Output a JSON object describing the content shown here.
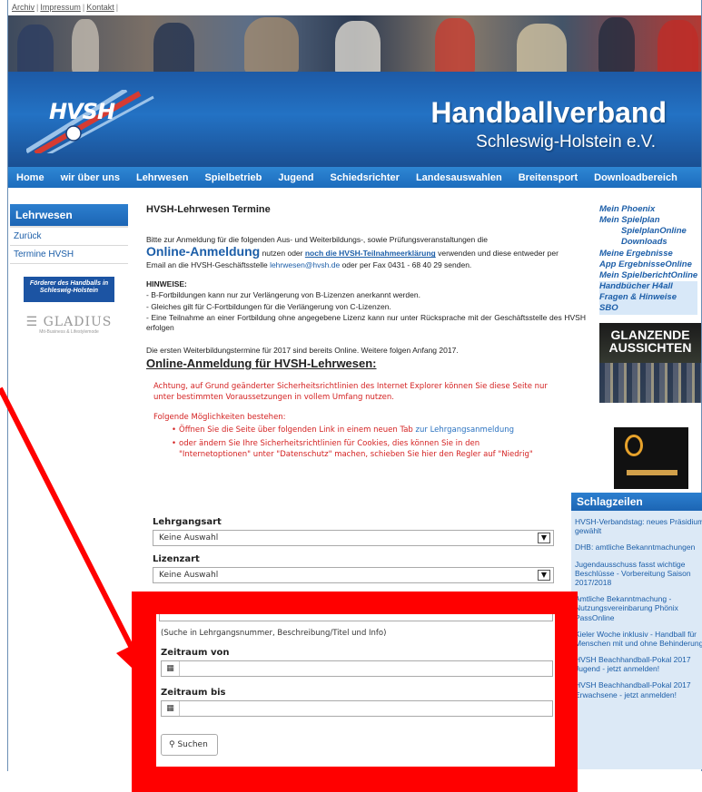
{
  "topbar": {
    "links": [
      "Archiv",
      "Impressum",
      "Kontakt"
    ]
  },
  "header": {
    "logo": "HVSH",
    "title": "Handballverband",
    "subtitle": "Schleswig-Holstein e.V."
  },
  "nav": [
    "Home",
    "wir über uns",
    "Lehrwesen",
    "Spielbetrieb",
    "Jugend",
    "Schiedsrichter",
    "Landesauswahlen",
    "Breitensport",
    "Downloadbereich"
  ],
  "sidebar": {
    "title": "Lehrwesen",
    "links": [
      "Zurück",
      "Termine HVSH"
    ],
    "sponsor1": "Förderer des Handballs in Schleswig-Holstein",
    "sponsor2_name": "GLADIUS",
    "sponsor2_tag": "Mit-Business & Lifestylemode"
  },
  "content": {
    "heading": "HVSH-Lehrwesen Termine",
    "intro_line1": "Bitte zur Anmeldung für die folgenden Aus- und Weiterbildungs-, sowie Prüfungsveranstaltungen die",
    "online_label": "Online-Anmeldung",
    "intro_mid": " nutzen oder ",
    "intro_link": "noch die HVSH-Teilnahmeerklärung",
    "intro_end": " verwenden und diese entweder per",
    "intro_line2_start": "Email an die HVSH-Geschäftsstelle ",
    "email": "lehrwesen@hvsh.de",
    "intro_line2_end": "  oder per Fax 0431 - 68 40 29 senden.",
    "hints_title": "HINWEISE:",
    "hints": [
      "-  B-Fortbildungen kann nur zur Verlängerung von B-Lizenzen anerkannt werden.",
      "-  Gleiches gilt für C-Fortbildungen für die Verlängerung von C-Lizenzen.",
      "-  Eine Teilnahme an einer Fortbildung ohne angegebene Lizenz kann nur unter Rücksprache mit der Geschäftsstelle des HVSH erfolgen"
    ],
    "info": "Die ersten Weiterbildungstermine für 2017 sind bereits Online. Weitere folgen Anfang 2017.",
    "online_heading": "Online-Anmeldung für HVSH-Lehrwesen:",
    "ie_warning": "Achtung, auf Grund geänderter Sicherheitsrichtlinien des Internet Explorer können Sie diese Seite nur unter bestimmten Voraussetzungen in vollem Umfang nutzen.",
    "options_intro": "Folgende Möglichkeiten bestehen:",
    "option1_text": "Öffnen Sie die Seite über folgenden Link in einem neuen Tab ",
    "option1_link": "zur Lehrgangsanmeldung",
    "option2_text": "oder ändern Sie Ihre Sicherheitsrichtlinien für Cookies, dies können Sie in den \"Internetoptionen\" unter \"Datenschutz\" machen, schieben Sie hier den Regler auf \"Niedrig\""
  },
  "form": {
    "lehrgangsart_label": "Lehrgangsart",
    "lehrgangsart_value": "Keine Auswahl",
    "lizenzart_label": "Lizenzart",
    "lizenzart_value": "Keine Auswahl",
    "search_hint": "(Suche in Lehrgangsnummer, Beschreibung/Titel und Info)",
    "from_label": "Zeitraum von",
    "to_label": "Zeitraum bis",
    "search_button": "Suchen"
  },
  "right": {
    "links": [
      "Mein Phoenix",
      "Mein Spielplan"
    ],
    "indented": [
      "SpielplanOnline",
      "Downloads"
    ],
    "links2": [
      "Meine Ergebnisse",
      "App ErgebnisseOnline",
      "Mein SpielberichtOnline"
    ],
    "highlighted": [
      "Handbücher H4all",
      "Fragen & Hinweise SBO"
    ],
    "banner_line1": "GLANZENDE",
    "banner_line2": "AUSSICHTEN"
  },
  "schlagzeilen": {
    "title": "Schlagzeilen",
    "items": [
      "HVSH-Verbandstag: neues Präsidium gewählt",
      "DHB: amtliche Bekanntmachungen",
      "Jugendausschuss fasst wichtige Beschlüsse - Vorbereitung Saison 2017/2018",
      "Amtliche Bekanntmachung - Nutzungsvereinbarung Phönix PassOnline",
      "Kieler Woche inklusiv - Handball für Menschen mit und ohne Behinderung",
      "HVSH Beachhandball-Pokal 2017 Jugend - jetzt anmelden!",
      "HVSH Beachhandball-Pokal 2017 Erwachsene - jetzt anmelden!"
    ]
  },
  "colors": {
    "brand_blue": "#1c5ea8",
    "annotation_red": "#ff0000",
    "warning_red": "#d42222"
  }
}
